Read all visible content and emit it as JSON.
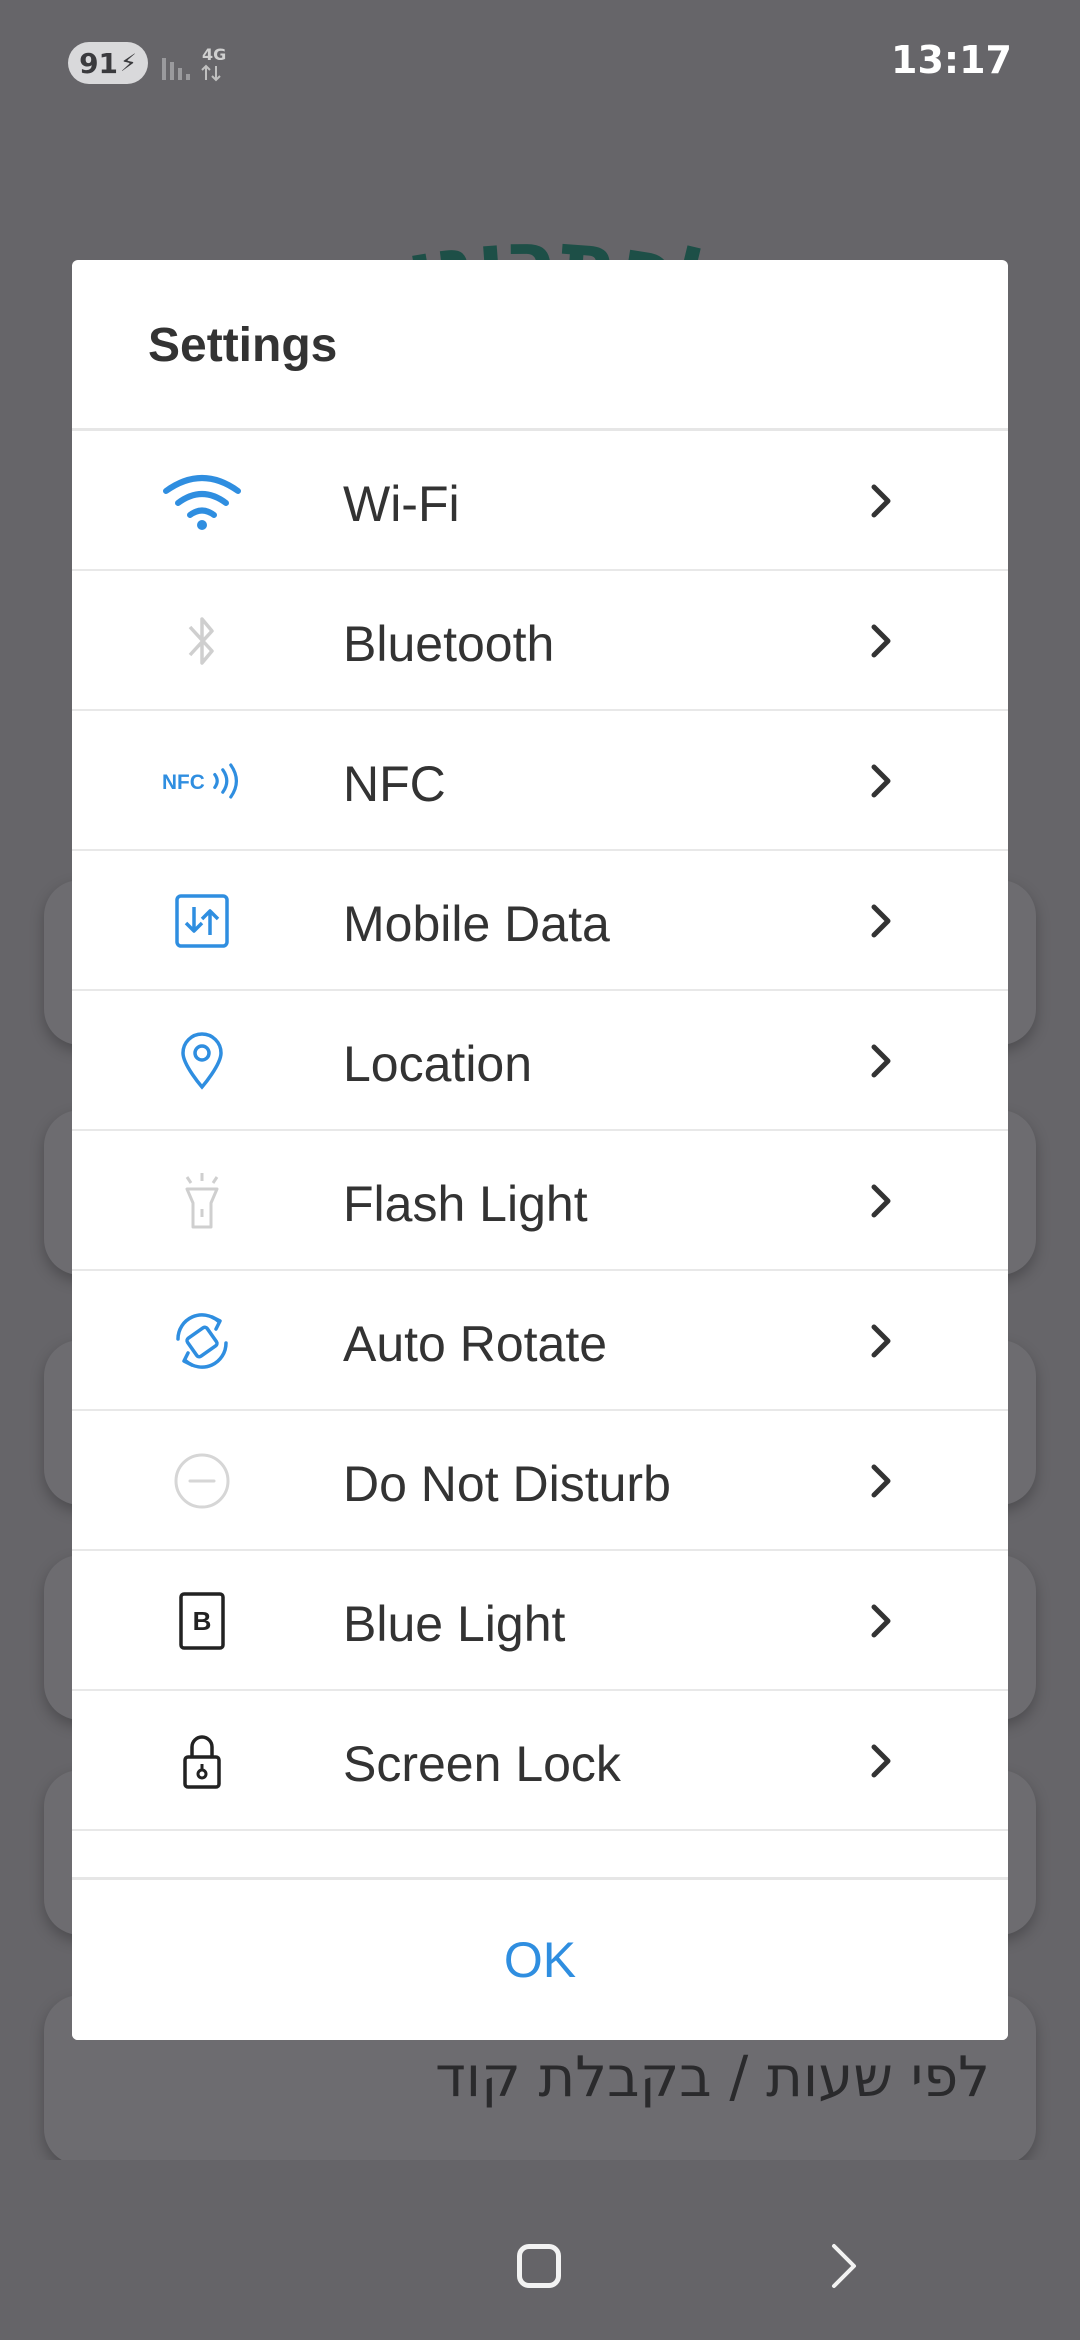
{
  "status_bar": {
    "battery": "91",
    "network": "4G",
    "time": "13:17"
  },
  "background": {
    "arc_title": "לה לפתרונות טכ",
    "card_text": "לפי שעות / בקבלת קוד"
  },
  "dialog": {
    "title": "Settings",
    "items": [
      {
        "label": "Wi-Fi",
        "icon": "wifi-icon",
        "icon_color": "#2f8ee0"
      },
      {
        "label": "Bluetooth",
        "icon": "bluetooth-icon",
        "icon_color": "#cfcfcf"
      },
      {
        "label": "NFC",
        "icon": "nfc-icon",
        "icon_color": "#2f8ee0",
        "icon_text": "NFC"
      },
      {
        "label": "Mobile Data",
        "icon": "mobile-data-icon",
        "icon_color": "#2f8ee0"
      },
      {
        "label": "Location",
        "icon": "location-pin-icon",
        "icon_color": "#2f8ee0"
      },
      {
        "label": "Flash Light",
        "icon": "flashlight-icon",
        "icon_color": "#cfcfcf"
      },
      {
        "label": "Auto Rotate",
        "icon": "auto-rotate-icon",
        "icon_color": "#2f8ee0"
      },
      {
        "label": "Do Not Disturb",
        "icon": "do-not-disturb-icon",
        "icon_color": "#cfcfcf"
      },
      {
        "label": "Blue Light",
        "icon": "blue-light-icon",
        "icon_color": "#222222",
        "icon_text": "B"
      },
      {
        "label": "Screen Lock",
        "icon": "screen-lock-icon",
        "icon_color": "#222222"
      }
    ],
    "ok_label": "OK"
  },
  "colors": {
    "accent": "#2f8ee0",
    "scrim": "#666569",
    "disabled_icon": "#cfcfcf"
  }
}
